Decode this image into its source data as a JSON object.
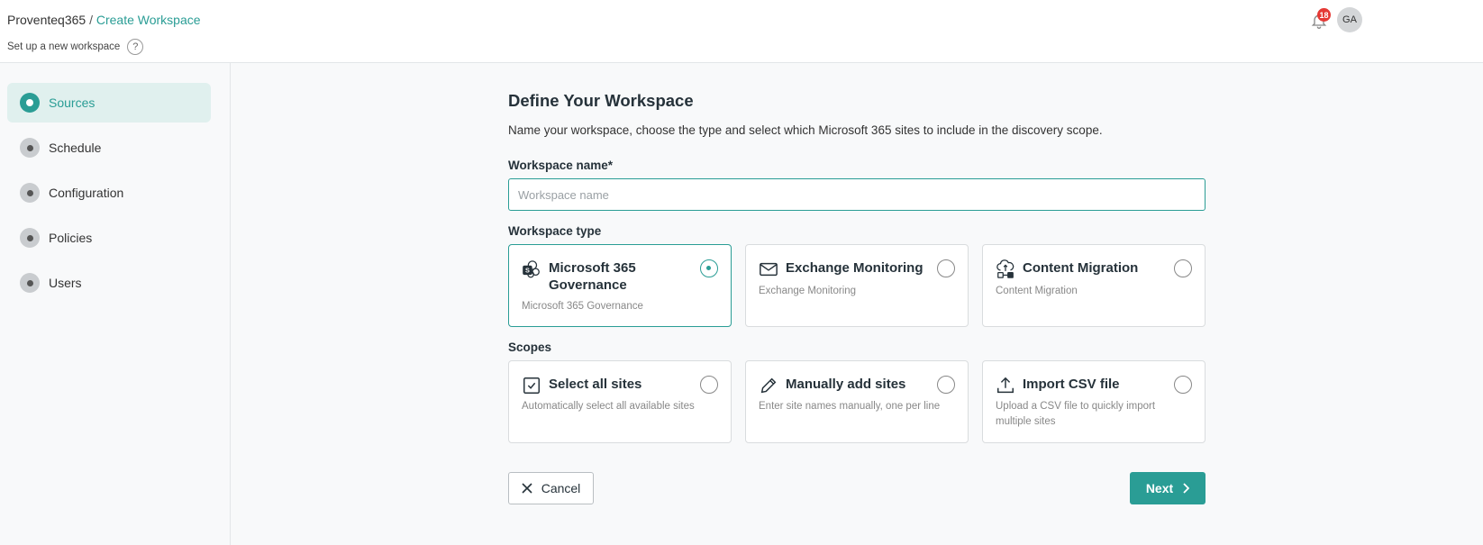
{
  "header": {
    "breadcrumb_root": "Proventeq365",
    "breadcrumb_sep": "/",
    "breadcrumb_current": "Create Workspace",
    "subtitle": "Set up a new workspace",
    "help_glyph": "?",
    "notification_count": "18",
    "avatar_initials": "GA"
  },
  "sidebar": {
    "items": [
      {
        "label": "Sources",
        "active": true
      },
      {
        "label": "Schedule",
        "active": false
      },
      {
        "label": "Configuration",
        "active": false
      },
      {
        "label": "Policies",
        "active": false
      },
      {
        "label": "Users",
        "active": false
      }
    ]
  },
  "main": {
    "title": "Define Your Workspace",
    "description": "Name your workspace, choose the type and select which Microsoft 365 sites to include in the discovery scope.",
    "name_label": "Workspace name*",
    "name_placeholder": "Workspace name",
    "name_value": "",
    "type_label": "Workspace type",
    "types": [
      {
        "title": "Microsoft 365 Governance",
        "desc": "Microsoft 365 Governance",
        "icon": "sharepoint-icon",
        "selected": true
      },
      {
        "title": "Exchange Monitoring",
        "desc": "Exchange Monitoring",
        "icon": "mail-icon",
        "selected": false
      },
      {
        "title": "Content Migration",
        "desc": "Content Migration",
        "icon": "cloud-migration-icon",
        "selected": false
      }
    ],
    "scopes_label": "Scopes",
    "scopes": [
      {
        "title": "Select all sites",
        "desc": "Automatically select all available sites",
        "icon": "checkbox-icon",
        "selected": false
      },
      {
        "title": "Manually add sites",
        "desc": "Enter site names manually, one per line",
        "icon": "pencil-icon",
        "selected": false
      },
      {
        "title": "Import CSV file",
        "desc": "Upload a CSV file to quickly import multiple sites",
        "icon": "upload-icon",
        "selected": false
      }
    ],
    "cancel_label": "Cancel",
    "next_label": "Next"
  },
  "colors": {
    "accent": "#2a9d95",
    "badge": "#e53935"
  }
}
